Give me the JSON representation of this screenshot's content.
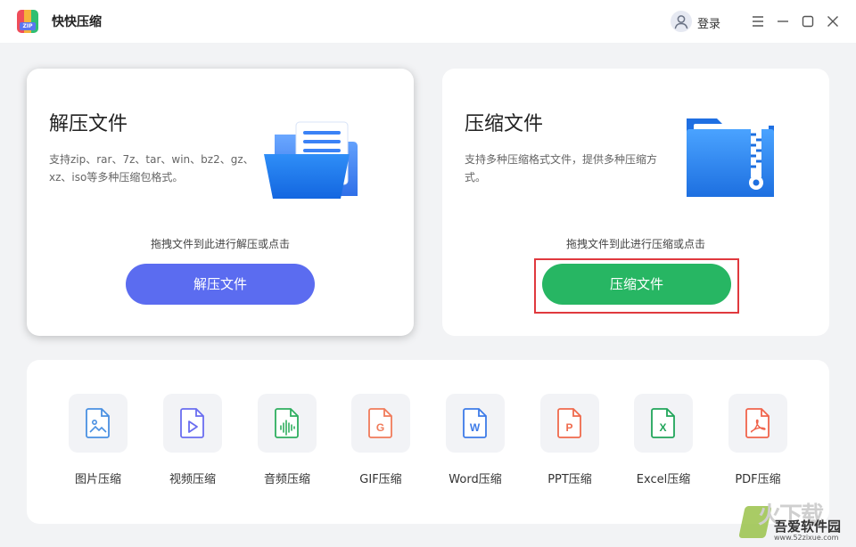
{
  "app": {
    "title": "快快压缩",
    "logo_text": "ZIP"
  },
  "header": {
    "login_label": "登录"
  },
  "decompress_card": {
    "title": "解压文件",
    "description": "支持zip、rar、7z、tar、win、bz2、gz、xz、iso等多种压缩包格式。",
    "hint": "拖拽文件到此进行解压或点击",
    "button_label": "解压文件"
  },
  "compress_card": {
    "title": "压缩文件",
    "description": "支持多种压缩格式文件，提供多种压缩方式。",
    "hint": "拖拽文件到此进行压缩或点击",
    "button_label": "压缩文件"
  },
  "tools": [
    {
      "label": "图片压缩",
      "icon": "image-file-icon",
      "letter": ""
    },
    {
      "label": "视频压缩",
      "icon": "video-file-icon",
      "letter": ""
    },
    {
      "label": "音频压缩",
      "icon": "audio-file-icon",
      "letter": ""
    },
    {
      "label": "GIF压缩",
      "icon": "gif-file-icon",
      "letter": "G"
    },
    {
      "label": "Word压缩",
      "icon": "word-file-icon",
      "letter": "W"
    },
    {
      "label": "PPT压缩",
      "icon": "ppt-file-icon",
      "letter": "P"
    },
    {
      "label": "Excel压缩",
      "icon": "excel-file-icon",
      "letter": "X"
    },
    {
      "label": "PDF压缩",
      "icon": "pdf-file-icon",
      "letter": ""
    }
  ],
  "watermark": {
    "big_text": "火下载",
    "name": "吾爱软件园",
    "url": "www.52zixue.com"
  },
  "colors": {
    "decompress_button": "#5b6cf0",
    "compress_button": "#27b663",
    "highlight_border": "#e0393e",
    "image_icon": "#4a90e2",
    "video_icon": "#6a6df0",
    "audio_icon": "#2fae5f",
    "gif_icon": "#f07b5a",
    "word_icon": "#3d7be8",
    "ppt_icon": "#ef6a4c",
    "excel_icon": "#21a55a",
    "pdf_icon": "#f0644c"
  }
}
